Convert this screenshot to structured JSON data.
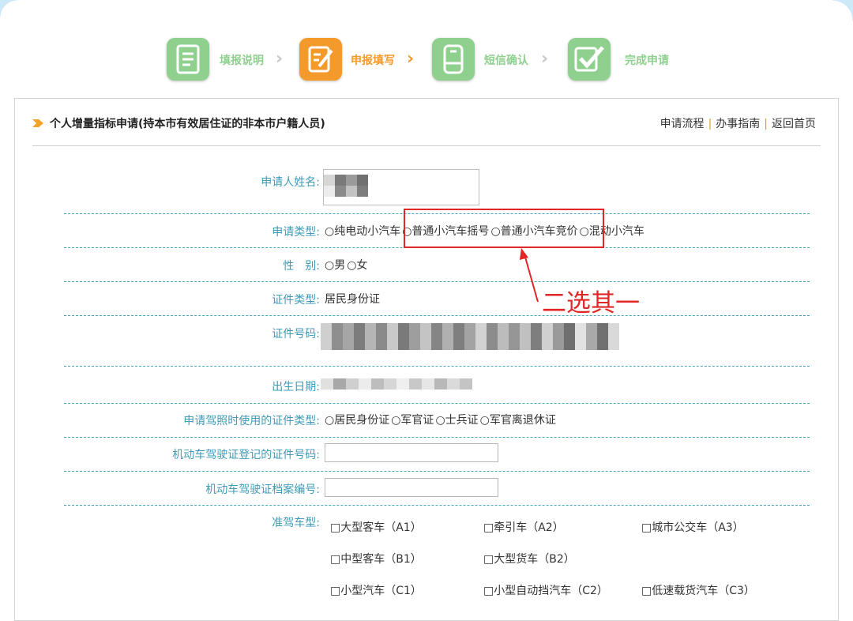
{
  "steps": [
    {
      "label": "填报说明",
      "icon": "document-icon",
      "color": "#8fd08f",
      "active": false
    },
    {
      "label": "申报填写",
      "icon": "edit-form-icon",
      "color": "#f39a2b",
      "active": true
    },
    {
      "label": "短信确认",
      "icon": "phone-icon",
      "color": "#8fd08f",
      "active": false
    },
    {
      "label": "完成申请",
      "icon": "checkmark-icon",
      "color": "#8fd08f",
      "active": false
    }
  ],
  "header": {
    "title": "个人增量指标申请(持本市有效居住证的非本市户籍人员)",
    "links": [
      "申请流程",
      "办事指南",
      "返回首页"
    ],
    "separator": "|"
  },
  "form": {
    "name_label": "申请人姓名:",
    "type_label": "申请类型:",
    "type_options": [
      "○纯电动小汽车",
      "○普通小汽车摇号",
      "○普通小汽车竞价",
      "○混动小汽车"
    ],
    "gender_label": "性　别:",
    "gender_options": [
      "○男",
      "○女"
    ],
    "id_type_label": "证件类型:",
    "id_type_value": "居民身份证",
    "id_number_label": "证件号码:",
    "birth_label": "出生日期:",
    "license_id_type_label": "申请驾照时使用的证件类型:",
    "license_id_type_options": [
      "○居民身份证",
      "○军官证",
      "○士兵证",
      "○军官离退休证"
    ],
    "license_number_label": "机动车驾驶证登记的证件号码:",
    "license_archive_label": "机动车驾驶证档案编号:",
    "vehicle_type_label": "准驾车型:",
    "vehicle_types": [
      "□大型客车（A1）",
      "□牵引车（A2）",
      "□城市公交车（A3）",
      "□中型客车（B1）",
      "□大型货车（B2）",
      "□小型汽车（C1）",
      "□小型自动挡汽车（C2）",
      "□低速载货汽车（C3）"
    ]
  },
  "annotation": {
    "text": "二选其一",
    "color": "#e02626"
  }
}
